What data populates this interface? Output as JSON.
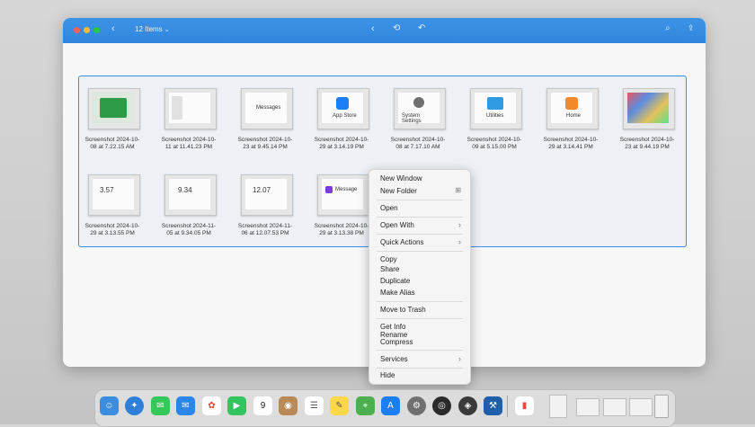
{
  "window": {
    "items_label": "12 Items",
    "colors": {
      "close": "#ff5f57",
      "minimize": "#febc2e",
      "zoom": "#28c840",
      "titlebar": "#3589df"
    }
  },
  "files": [
    {
      "label": "Screenshot 2024-10-\n08 at 7.22.15 AM",
      "thumb_text": ""
    },
    {
      "label": "Screenshot 2024-10-\n11 at 11.41.23 PM",
      "thumb_text": ""
    },
    {
      "label": "Screenshot 2024-10-\n23 at 9.45.14 PM",
      "thumb_text": "Messages"
    },
    {
      "label": "Screenshot 2024-10-\n29 at 3.14.19 PM",
      "thumb_text": "App Store"
    },
    {
      "label": "Screenshot 2024-10-\n08 at 7.17.10 AM",
      "thumb_text": "System Settings"
    },
    {
      "label": "Screenshot 2024-10-\n09 at 5.15.00 PM",
      "thumb_text": "Utilities"
    },
    {
      "label": "Screenshot 2024-10-\n29 at 3.14.41 PM",
      "thumb_text": "Home"
    },
    {
      "label": "Screenshot 2024-10-\n23 at 9.44.19 PM",
      "thumb_text": ""
    },
    {
      "label": "Screenshot 2024-10-\n29 at 3.13.55 PM",
      "thumb_text": "3.57"
    },
    {
      "label": "Screenshot 2024-11-\n05 at 9.34.05 PM",
      "thumb_text": "9.34"
    },
    {
      "label": "Screenshot 2024-11-\n06 at 12.07.53 PM",
      "thumb_text": "12.07"
    },
    {
      "label": "Screenshot 2024-10-\n29 at 3.13.38 PM",
      "thumb_text": "Message"
    }
  ],
  "context_menu": {
    "new_window": "New Window",
    "new_folder": "New Folder",
    "open": "Open",
    "open_with": "Open With",
    "quick_actions": "Quick Actions",
    "copy": "Copy",
    "share": "Share",
    "duplicate": "Duplicate",
    "make_alias": "Make Alias",
    "move_to_trash": "Move to Trash",
    "get_info": "Get Info",
    "rename": "Rename",
    "compress": "Compress",
    "services": "Services",
    "hide": "Hide"
  },
  "dock": {
    "calendar_day": "9"
  }
}
